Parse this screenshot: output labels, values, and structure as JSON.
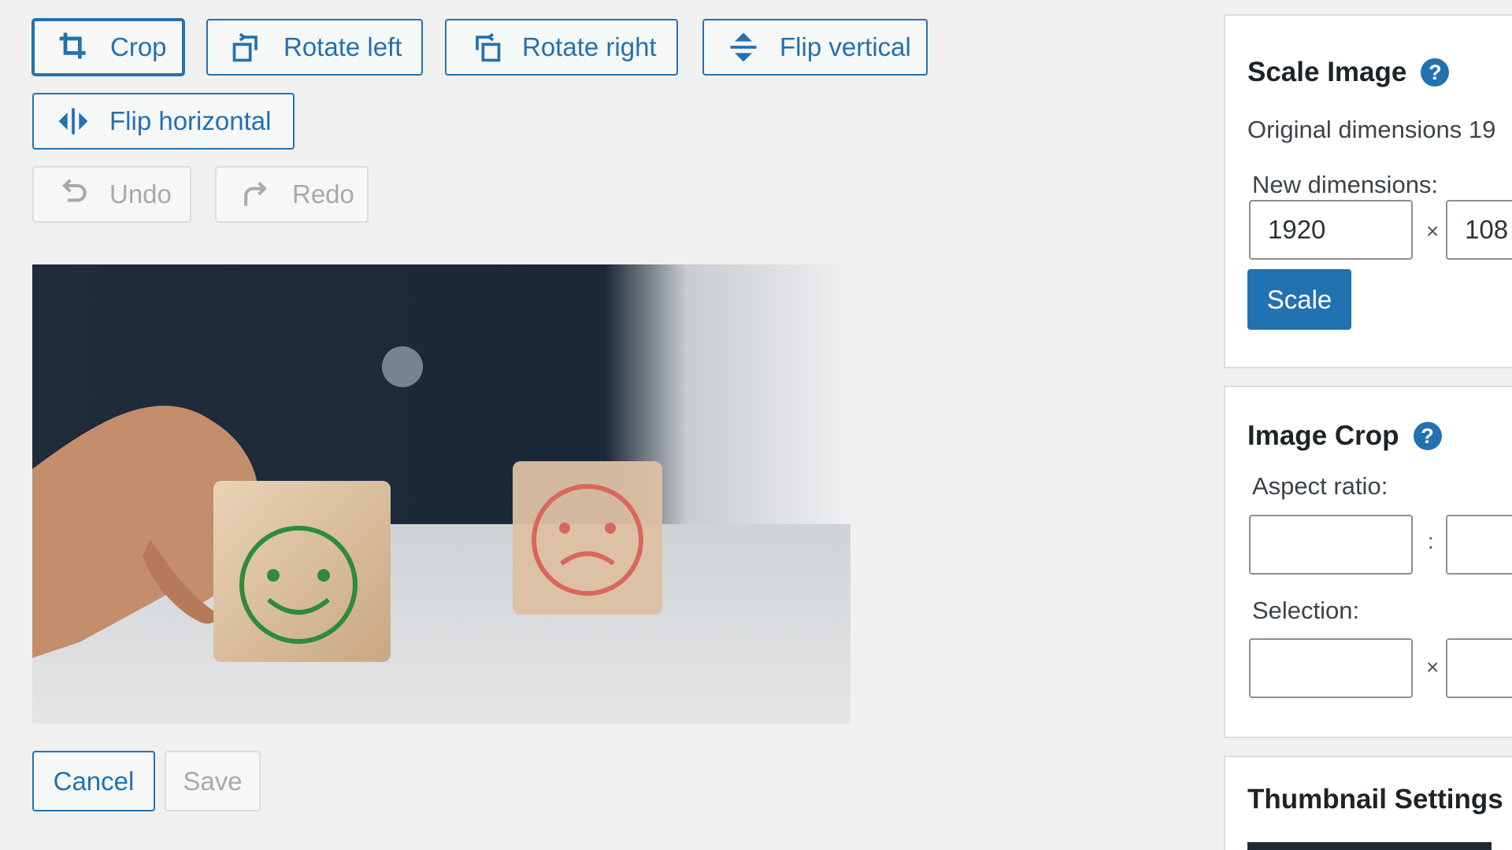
{
  "toolbar": {
    "crop": "Crop",
    "rotate_left": "Rotate left",
    "rotate_right": "Rotate right",
    "flip_vertical": "Flip vertical",
    "flip_horizontal": "Flip horizontal",
    "undo": "Undo",
    "redo": "Redo"
  },
  "actions": {
    "cancel": "Cancel",
    "save": "Save"
  },
  "scale_panel": {
    "title": "Scale Image",
    "help": "?",
    "original_dimensions": "Original dimensions 19",
    "new_dimensions_label": "New dimensions:",
    "width_value": "1920",
    "height_value": "108",
    "times": "×",
    "scale_button": "Scale"
  },
  "crop_panel": {
    "title": "Image Crop",
    "help": "?",
    "aspect_ratio_label": "Aspect ratio:",
    "colon": ":",
    "selection_label": "Selection:",
    "times": "×"
  },
  "thumb_panel": {
    "title": "Thumbnail Settings"
  },
  "icons": {
    "crop": "crop-icon",
    "rotate_left": "rotate-left-icon",
    "rotate_right": "rotate-right-icon",
    "flip_vertical": "flip-vertical-icon",
    "flip_horizontal": "flip-horizontal-icon",
    "undo": "undo-icon",
    "redo": "redo-icon",
    "help": "help-icon"
  },
  "colors": {
    "accent": "#2271b1",
    "disabled": "#a7aaad",
    "background": "#f0f0f1"
  }
}
